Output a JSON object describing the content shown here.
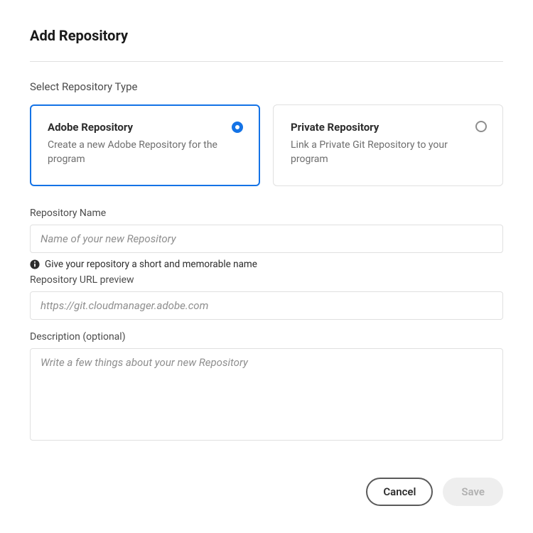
{
  "title": "Add Repository",
  "section_label": "Select Repository Type",
  "type_options": {
    "adobe": {
      "title": "Adobe Repository",
      "desc": "Create a new Adobe Repository for the program"
    },
    "private": {
      "title": "Private Repository",
      "desc": "Link a Private Git Repository to your program"
    }
  },
  "fields": {
    "name": {
      "label": "Repository Name",
      "placeholder": "Name of your new Repository",
      "hint": "Give your repository a short and memorable name"
    },
    "url": {
      "label": "Repository URL preview",
      "placeholder": "https://git.cloudmanager.adobe.com"
    },
    "description": {
      "label": "Description (optional)",
      "placeholder": "Write a few things about your new Repository"
    }
  },
  "footer": {
    "cancel": "Cancel",
    "save": "Save"
  }
}
